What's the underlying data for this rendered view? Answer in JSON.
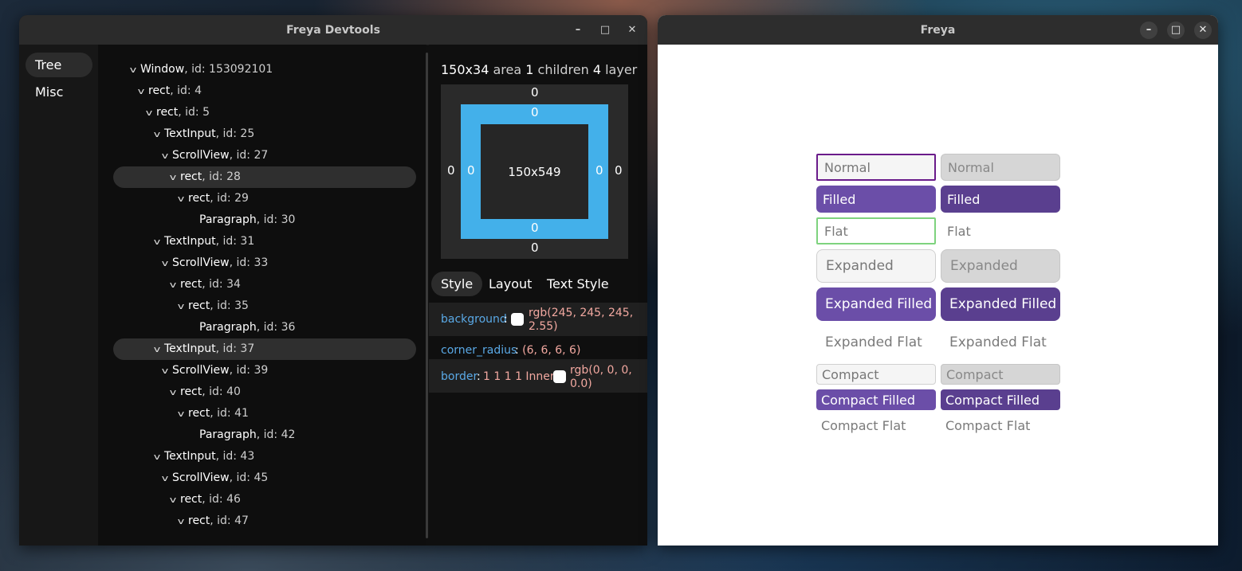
{
  "devtools": {
    "title": "Freya Devtools",
    "window_buttons": [
      "–",
      "□",
      "✕"
    ],
    "sidebar": [
      {
        "label": "Tree",
        "active": true
      },
      {
        "label": "Misc",
        "active": false
      }
    ],
    "tree": [
      {
        "name": "Window",
        "id": ", id: 153092101"
      },
      {
        "name": "rect",
        "id": ", id: 4"
      },
      {
        "name": "rect",
        "id": ", id: 5"
      },
      {
        "name": "TextInput",
        "id": ", id: 25"
      },
      {
        "name": "ScrollView",
        "id": ", id: 27"
      },
      {
        "name": "rect",
        "id": ", id: 28"
      },
      {
        "name": "rect",
        "id": ", id: 29"
      },
      {
        "name": "Paragraph",
        "id": ", id: 30"
      },
      {
        "name": "TextInput",
        "id": ", id: 31"
      },
      {
        "name": "ScrollView",
        "id": ", id: 33"
      },
      {
        "name": "rect",
        "id": ", id: 34"
      },
      {
        "name": "rect",
        "id": ", id: 35"
      },
      {
        "name": "Paragraph",
        "id": ", id: 36"
      },
      {
        "name": "TextInput",
        "id": ", id: 37"
      },
      {
        "name": "ScrollView",
        "id": ", id: 39"
      },
      {
        "name": "rect",
        "id": ", id: 40"
      },
      {
        "name": "rect",
        "id": ", id: 41"
      },
      {
        "name": "Paragraph",
        "id": ", id: 42"
      },
      {
        "name": "TextInput",
        "id": ", id: 43"
      },
      {
        "name": "ScrollView",
        "id": ", id: 45"
      },
      {
        "name": "rect",
        "id": ", id: 46"
      },
      {
        "name": "rect",
        "id": ", id: 47"
      }
    ],
    "inspector": {
      "size": "150x34",
      "area_label": "area",
      "children_count": "1",
      "children_label": "children",
      "layer_count": "4",
      "layer_label": "layer",
      "box": {
        "margin_top": "0",
        "margin_bottom": "0",
        "margin_left": "0",
        "margin_right": "0",
        "padding_top": "0",
        "padding_bottom": "0",
        "padding_left": "0",
        "padding_right": "0",
        "inner": "150x549"
      },
      "tabs": [
        "Style",
        "Layout",
        "Text Style"
      ],
      "props": {
        "background_name": "background",
        "background_value": "rgb(245, 245, 245, 2.55)",
        "corner_name": "corner_radius",
        "corner_value": "(6, 6, 6, 6)",
        "border_name": "border",
        "border_prefix": "1 1 1 1 Inner",
        "border_value": "rgb(0, 0, 0, 0.0)"
      }
    }
  },
  "app": {
    "title": "Freya",
    "window_buttons": [
      "–",
      "□",
      "✕"
    ],
    "inputs": {
      "normal": "Normal",
      "filled": "Filled",
      "flat": "Flat",
      "expanded": "Expanded",
      "expanded_filled": "Expanded Filled",
      "expanded_flat": "Expanded Flat",
      "compact": "Compact",
      "compact_filled": "Compact Filled",
      "compact_flat": "Compact Flat"
    }
  }
}
